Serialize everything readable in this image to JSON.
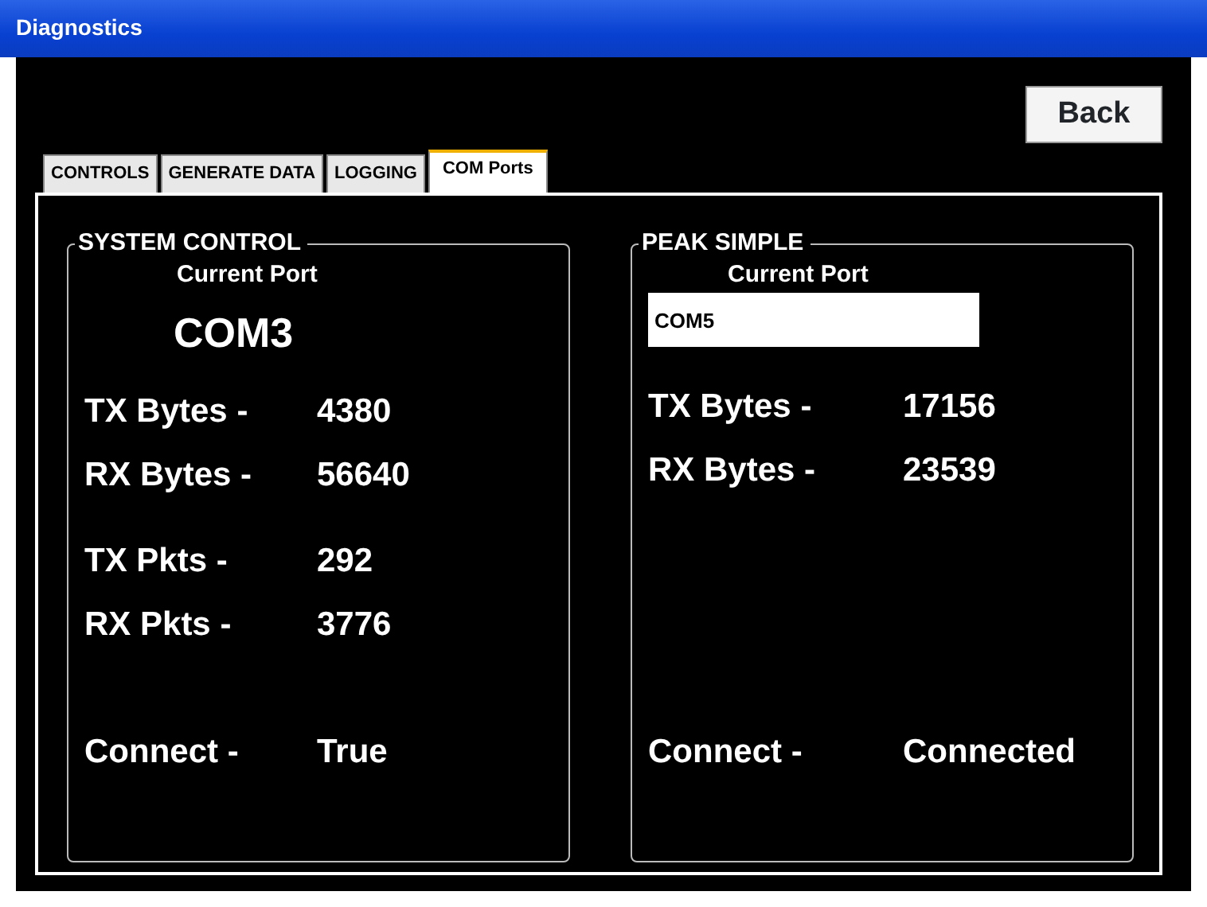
{
  "window": {
    "title": "Diagnostics"
  },
  "back_button": "Back",
  "tabs": [
    {
      "label": "CONTROLS",
      "selected": false
    },
    {
      "label": "GENERATE DATA",
      "selected": false
    },
    {
      "label": "LOGGING",
      "selected": false
    },
    {
      "label": "COM Ports",
      "selected": true
    }
  ],
  "panels": [
    {
      "title": "SYSTEM CONTROL",
      "port_label": "Current Port",
      "port": {
        "kind": "text",
        "value": "COM3"
      },
      "byte_stats": [
        {
          "label": "TX Bytes -",
          "value": "4380"
        },
        {
          "label": "RX Bytes -",
          "value": "56640"
        }
      ],
      "packet_stats": [
        {
          "label": "TX Pkts -",
          "value": "292"
        },
        {
          "label": "RX Pkts -",
          "value": "3776"
        }
      ],
      "connection": {
        "label": "Connect -",
        "value": "True"
      }
    },
    {
      "title": "PEAK SIMPLE",
      "port_label": "Current Port",
      "port": {
        "kind": "field",
        "value": "COM5"
      },
      "byte_stats": [
        {
          "label": "TX Bytes -",
          "value": "17156"
        },
        {
          "label": "RX Bytes -",
          "value": "23539"
        }
      ],
      "connection": {
        "label": "Connect -",
        "value": "Connected"
      }
    }
  ]
}
